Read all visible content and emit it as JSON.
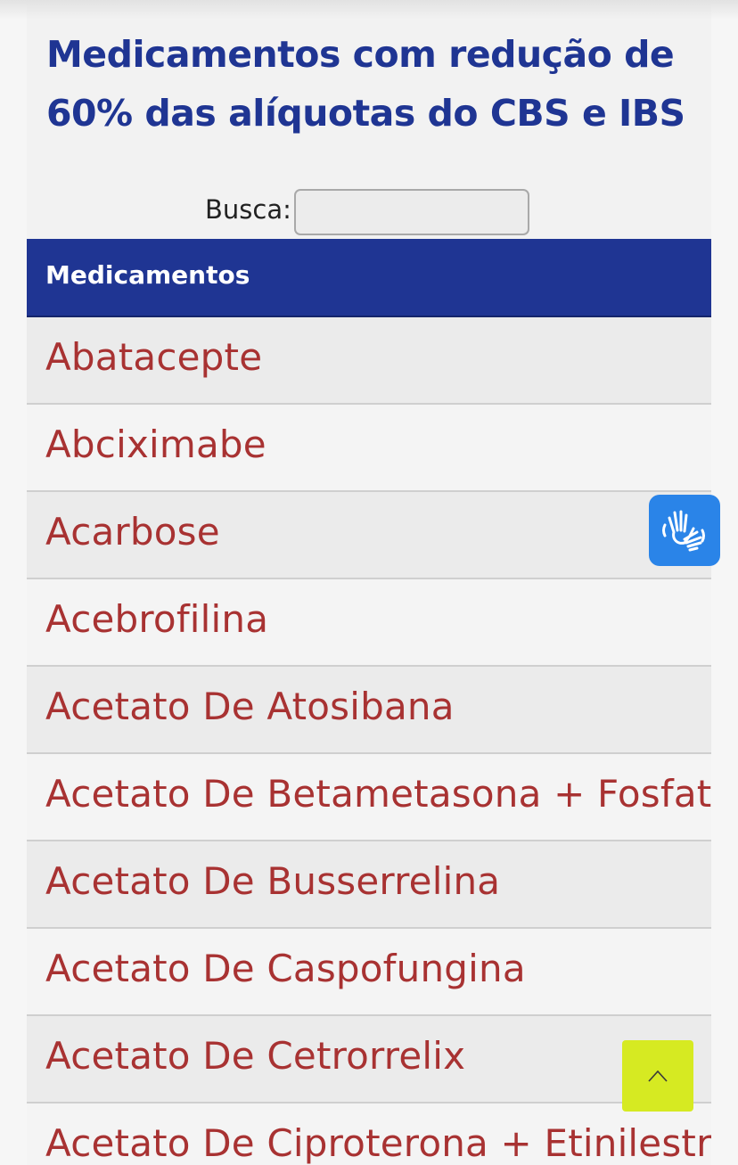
{
  "page": {
    "title": "Medicamentos com redução de 60% das alíquotas do CBS e IBS"
  },
  "search": {
    "label": "Busca:",
    "value": "",
    "placeholder": ""
  },
  "table": {
    "header": "Medicamentos",
    "rows": [
      "Abatacepte",
      "Abciximabe",
      "Acarbose",
      "Acebrofilina",
      "Acetato De Atosibana",
      "Acetato De Betametasona + Fosfato",
      "Acetato De Busserrelina",
      "Acetato De Caspofungina",
      "Acetato De Cetrorrelix",
      "Acetato De Ciproterona + Etinilestra"
    ]
  },
  "floating": {
    "libras_icon": "sign-language-hands-icon",
    "scroll_top_icon": "chevron-up-icon"
  },
  "colors": {
    "title": "#1f3593",
    "header_bg": "#1f3593",
    "row_text": "#a83232",
    "libras_bg": "#2a84e8",
    "scroll_top_bg": "#d6ea22"
  }
}
